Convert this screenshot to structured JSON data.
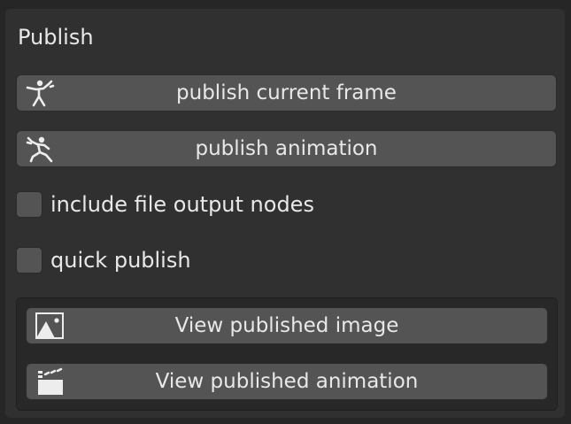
{
  "panel": {
    "title": "Publish"
  },
  "buttons": {
    "publish_frame": {
      "label": "publish current frame",
      "icon": "pose-figure-icon"
    },
    "publish_animation": {
      "label": "publish animation",
      "icon": "running-figure-icon"
    }
  },
  "options": {
    "include_file_output_nodes": {
      "label": "include file output nodes",
      "checked": false
    },
    "quick_publish": {
      "label": "quick publish",
      "checked": false
    }
  },
  "viewers": {
    "view_image": {
      "label": "View published image",
      "icon": "image-icon"
    },
    "view_animation": {
      "label": "View published animation",
      "icon": "clapperboard-icon"
    }
  },
  "colors": {
    "background": "#262626",
    "panel": "#303030",
    "button": "#545454",
    "text": "#e8e8e8"
  }
}
